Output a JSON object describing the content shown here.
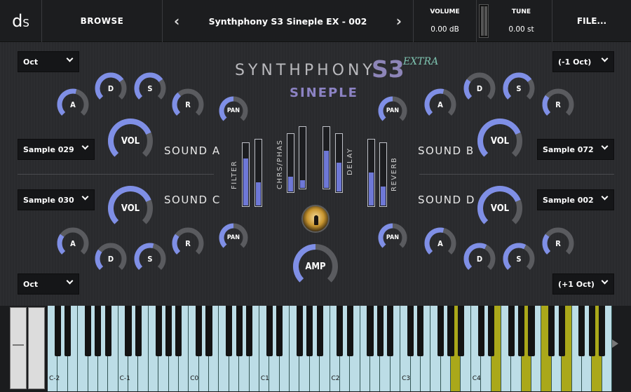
{
  "header": {
    "logo_main": "d",
    "logo_sub": "S",
    "browse_label": "BROWSE",
    "preset_name": "Synthphony S3 Sineple EX - 002",
    "prev_icon": "chevron-left-icon",
    "next_icon": "chevron-right-icon",
    "volume_label": "VOLUME",
    "volume_value": "0.00 dB",
    "tune_label": "TUNE",
    "tune_value": "0.00 st",
    "file_label": "FILE..."
  },
  "title": {
    "name": "SYNTHPHONY",
    "version": "S3",
    "edition": "EXTRA",
    "subtitle": "SINEPLE"
  },
  "colors": {
    "accent": "#7f8fe6",
    "knob_track": "#5a5b5f",
    "key_active": "#aaa81a",
    "fx_fill": "#6e78d6"
  },
  "sounds": {
    "a": {
      "label": "SOUND A",
      "octave": "Oct",
      "sample": "Sample 029",
      "knobs": {
        "A": 0.55,
        "D": 0.7,
        "S": 0.7,
        "R": 0.35,
        "PAN": 0.5,
        "VOL": 0.75
      }
    },
    "b": {
      "label": "SOUND B",
      "octave": "(-1 Oct)",
      "sample": "Sample 072",
      "knobs": {
        "A": 0.55,
        "D": 0.3,
        "S": 0.7,
        "R": 0.3,
        "PAN": 0.5,
        "VOL": 0.75
      }
    },
    "c": {
      "label": "SOUND C",
      "octave": "Oct",
      "sample": "Sample 030",
      "knobs": {
        "A": 0.3,
        "D": 0.3,
        "S": 0.55,
        "R": 0.3,
        "PAN": 0.5,
        "VOL": 0.75
      }
    },
    "d": {
      "label": "SOUND D",
      "octave": "(+1 Oct)",
      "sample": "Sample 002",
      "knobs": {
        "A": 0.55,
        "D": 0.6,
        "S": 0.6,
        "R": 0.3,
        "PAN": 0.5,
        "VOL": 0.75
      }
    }
  },
  "knob_labels": {
    "attack": "A",
    "decay": "D",
    "sustain": "S",
    "release": "R",
    "pan": "PAN",
    "volume": "VOL",
    "amp": "AMP"
  },
  "amp_level": 0.5,
  "fx": [
    {
      "name": "FILTER",
      "values": [
        0.75,
        0.35
      ]
    },
    {
      "name": "CHRS/PHAS",
      "values": [
        0.25,
        0.12
      ]
    },
    {
      "name": "DELAY",
      "values": [
        0.6,
        0.5
      ]
    },
    {
      "name": "REVERB",
      "values": [
        0.5,
        0.3
      ]
    }
  ],
  "keyboard": {
    "octave_labels": [
      "C-2",
      "C-1",
      "C0",
      "C1",
      "C2",
      "C3",
      "C4"
    ],
    "active_white_keys": [
      40,
      44,
      47,
      49,
      51,
      54
    ]
  }
}
